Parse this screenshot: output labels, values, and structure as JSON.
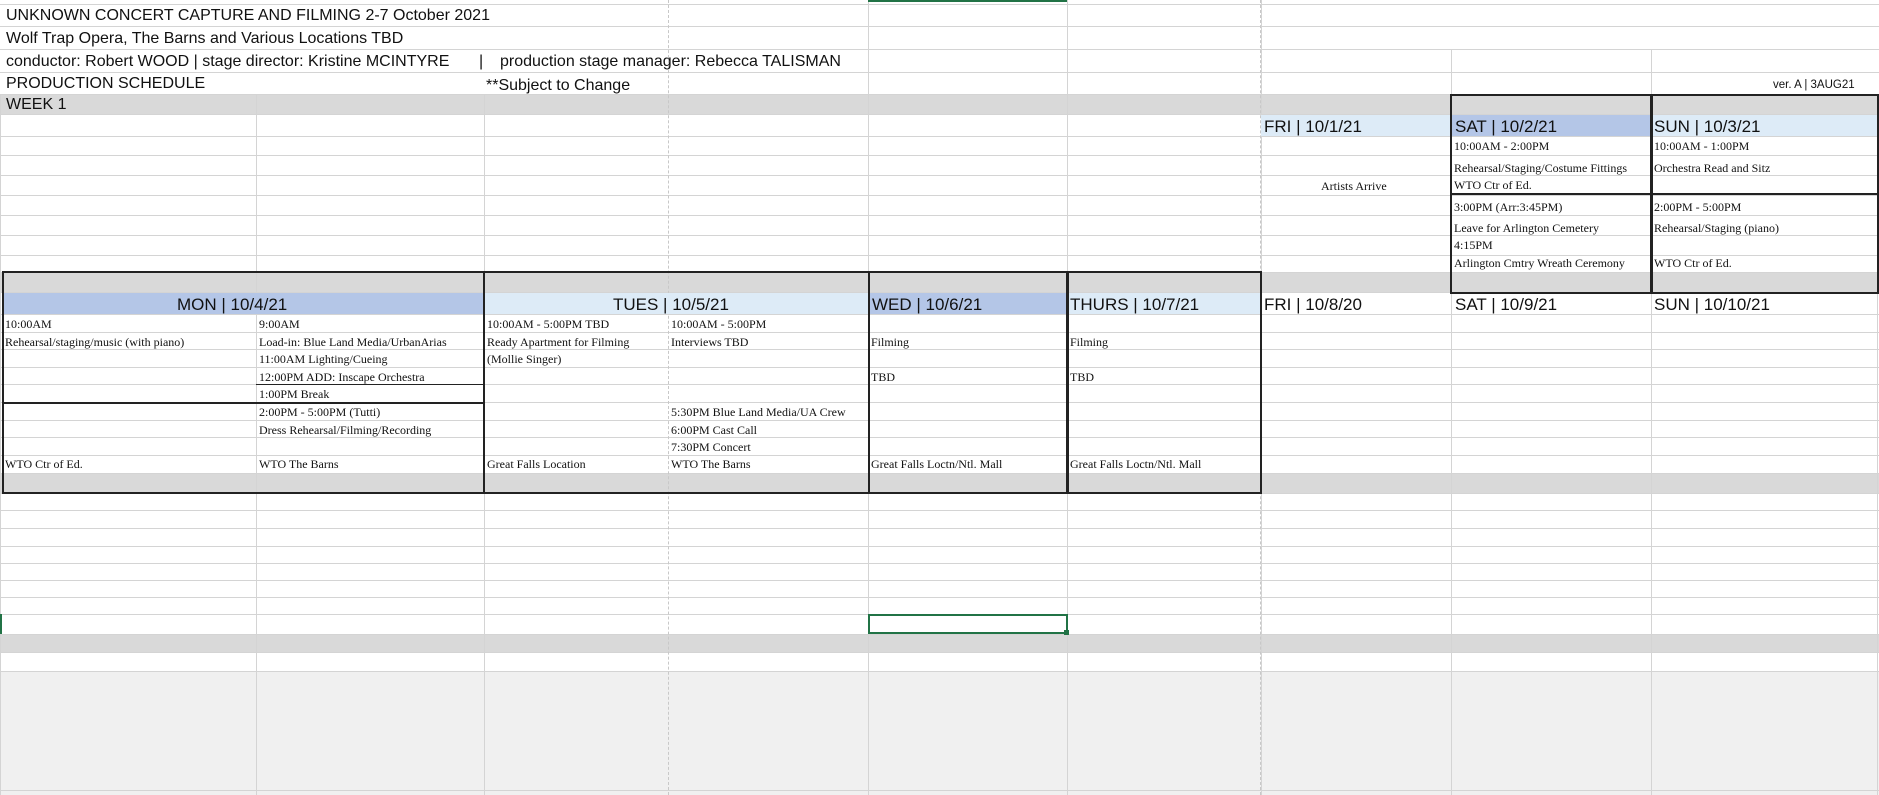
{
  "header": {
    "title": "UNKNOWN CONCERT CAPTURE AND FILMING 2-7 October 2021",
    "venue": "Wolf Trap Opera, The Barns and Various Locations TBD",
    "credits_left": "conductor: Robert WOOD | stage director: Kristine MCINTYRE",
    "credits_sep": "|",
    "credits_right": "production stage manager: Rebecca TALISMAN",
    "schedule_label": "PRODUCTION SCHEDULE",
    "subject_note": "**Subject to Change",
    "version": "ver. A  |  3AUG21",
    "week_label": "WEEK 1"
  },
  "week1": {
    "days": {
      "fri": "FRI | 10/1/21",
      "sat": "SAT | 10/2/21",
      "sun": "SUN | 10/3/21"
    },
    "fri_note": "Artists Arrive",
    "sat": [
      "10:00AM - 2:00PM",
      "Rehearsal/Staging/Costume Fittings",
      "WTO Ctr of Ed.",
      "3:00PM (Arr:3:45PM)",
      "Leave for Arlington Cemetery",
      "4:15PM",
      "Arlington Cmtry Wreath Ceremony"
    ],
    "sun": [
      "10:00AM - 1:00PM",
      "Orchestra Read and Sitz",
      "2:00PM - 5:00PM",
      "Rehearsal/Staging (piano)",
      "WTO Ctr of Ed."
    ]
  },
  "week2": {
    "days": {
      "mon": "MON | 10/4/21",
      "tue": "TUES | 10/5/21",
      "wed": "WED | 10/6/21",
      "thu": "THURS | 10/7/21",
      "fri": "FRI | 10/8/20",
      "sat": "SAT | 10/9/21",
      "sun": "SUN | 10/10/21"
    },
    "mon_a": [
      "10:00AM",
      "Rehearsal/staging/music (with piano)",
      "WTO Ctr of Ed."
    ],
    "mon_b": [
      "9:00AM",
      "Load-in: Blue Land Media/UrbanArias",
      "11:00AM Lighting/Cueing",
      "12:00PM ADD: Inscape Orchestra",
      "1:00PM Break",
      "2:00PM - 5:00PM (Tutti)",
      "Dress Rehearsal/Filming/Recording",
      "WTO The Barns"
    ],
    "tue_a": [
      "10:00AM - 5:00PM TBD",
      "Ready Apartment for Filming",
      "(Mollie Singer)",
      "Great Falls Location"
    ],
    "tue_b": [
      "10:00AM - 5:00PM",
      "Interviews TBD",
      "5:30PM Blue Land Media/UA Crew",
      "6:00PM Cast Call",
      "7:30PM Concert",
      "WTO The Barns"
    ],
    "wed": [
      "Filming",
      "TBD",
      "Great Falls Loctn/Ntl. Mall"
    ],
    "thu": [
      "Filming",
      "TBD",
      "Great Falls Loctn/Ntl. Mall"
    ]
  },
  "colors": {
    "header_blue": "#b4c6e7",
    "header_light_blue": "#ddebf7",
    "band_gray": "#d9d9d9",
    "selection_green": "#217346"
  }
}
